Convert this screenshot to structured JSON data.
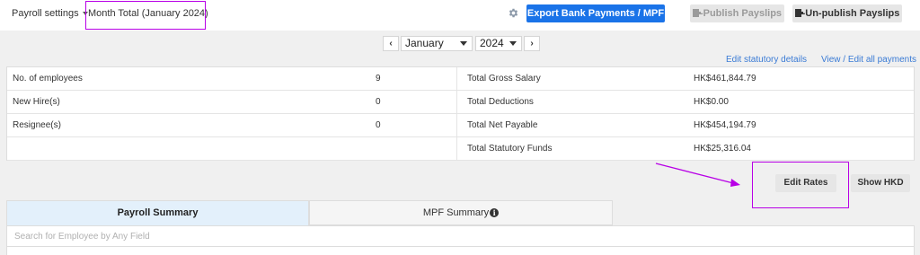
{
  "header": {
    "payroll_settings_label": "Payroll settings",
    "month_total_label": "Month Total (January 2024)",
    "export_button_label": "Export Bank Payments / MPF",
    "publish_button_label": "-Publish Payslips",
    "unpublish_button_label": "-Un-publish Payslips",
    "settings_icon": "gear-icon"
  },
  "period": {
    "prev_symbol": "‹",
    "next_symbol": "›",
    "month": "January",
    "year": "2024"
  },
  "links": {
    "edit_statutory": "Edit statutory details",
    "view_payments": "View / Edit all payments"
  },
  "summary": {
    "rows": [
      {
        "label": "No. of employees",
        "count": "9",
        "desc": "Total Gross Salary",
        "amount": "HK$461,844.79"
      },
      {
        "label": "New Hire(s)",
        "count": "0",
        "desc": "Total Deductions",
        "amount": "HK$0.00"
      },
      {
        "label": "Resignee(s)",
        "count": "0",
        "desc": "Total Net Payable",
        "amount": "HK$454,194.79"
      },
      {
        "label": "",
        "count": "",
        "desc": "Total Statutory Funds",
        "amount": "HK$25,316.04"
      }
    ]
  },
  "actions": {
    "edit_rates_label": "Edit Rates",
    "show_hkd_label": "Show HKD"
  },
  "tabs": {
    "payroll_summary": "Payroll Summary",
    "mpf_summary": "MPF Summary",
    "info_symbol": "i"
  },
  "search": {
    "placeholder": "Search for Employee by Any Field",
    "value": ""
  },
  "colors": {
    "primary_button": "#1a73e8",
    "annotation": "#b800e6",
    "link": "#3a7bd5",
    "active_tab": "#e3f0fb"
  }
}
